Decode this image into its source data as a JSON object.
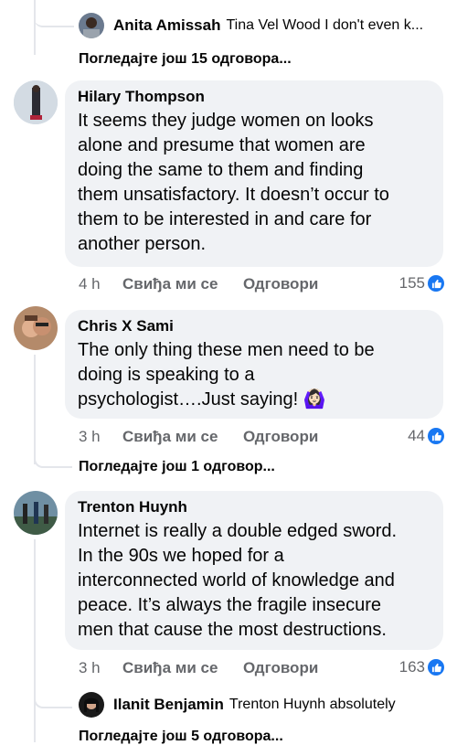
{
  "top_reply": {
    "author": "Anita Amissah",
    "text": "Tina Vel Wood  I don't even k..."
  },
  "view_more_1": "Погледајте још 15 одговора...",
  "comments": [
    {
      "author": "Hilary Thompson",
      "text": "It seems they judge women on looks\nalone and presume that women are\ndoing the same to them and finding\nthem unsatisfactory. It doesn’t occur to\nthem to be interested in and care for\nanother person.",
      "time": "4 h",
      "like_label": "Свиђа ми се",
      "reply_label": "Одговори",
      "reactions": "155"
    },
    {
      "author": "Chris X Sami",
      "text": "The only thing these men need to be\ndoing is speaking to a\npsychologist….Just saying! 🙆🏻‍♀️",
      "time": "3 h",
      "like_label": "Свиђа ми се",
      "reply_label": "Одговори",
      "reactions": "44"
    },
    {
      "author": "Trenton Huynh",
      "text": "Internet is really a double edged sword.\nIn the 90s we hoped for a\ninterconnected world of knowledge and\npeace. It’s always the fragile insecure\nmen that cause the most destructions.",
      "time": "3 h",
      "like_label": "Свиђа ми се",
      "reply_label": "Одговори",
      "reactions": "163"
    }
  ],
  "view_more_2": "Погледајте још 1 одговор...",
  "bottom_reply": {
    "author": "Ilanit Benjamin",
    "text": "Trenton Huynh absolutely"
  },
  "view_more_3": "Погледајте још 5 одговора...",
  "colors": {
    "bubble": "#f0f2f5",
    "like_blue": "#1877f2",
    "meta_gray": "#65676b",
    "thread_line": "#e4e6eb"
  }
}
